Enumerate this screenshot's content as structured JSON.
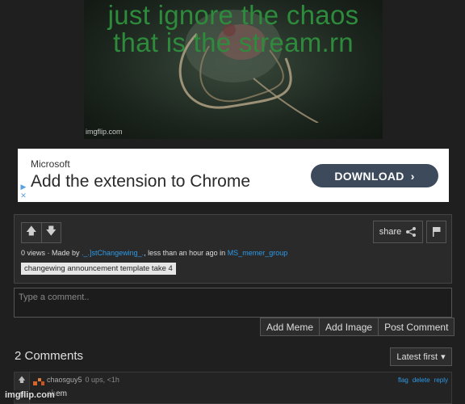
{
  "meme": {
    "caption": "just ignore the chaos that is the stream.rn",
    "watermark": "imgflip.com"
  },
  "ad": {
    "company": "Microsoft",
    "headline": "Add the extension to Chrome",
    "button_label": "DOWNLOAD"
  },
  "info": {
    "share_label": "share",
    "views": "0 views",
    "made_by_prefix": " · Made by ",
    "author": "._.]stChangewing_.",
    "time_text": ", less than an hour ago in ",
    "stream": "MS_memer_group",
    "tag_bold": "changewing",
    "tag_rest": " announcement template take 4"
  },
  "comment_form": {
    "placeholder": "Type a comment..",
    "buttons": [
      "Add Meme",
      "Add Image",
      "Post Comment"
    ]
  },
  "comments": {
    "title": "2 Comments",
    "sort_label": "Latest first",
    "items": [
      {
        "user": "chaosguy5",
        "stats": "0 ups, <1h",
        "actions": [
          "flag",
          "delete",
          "reply"
        ],
        "text": "ahem"
      }
    ]
  },
  "footer_watermark": "imgflip.com"
}
